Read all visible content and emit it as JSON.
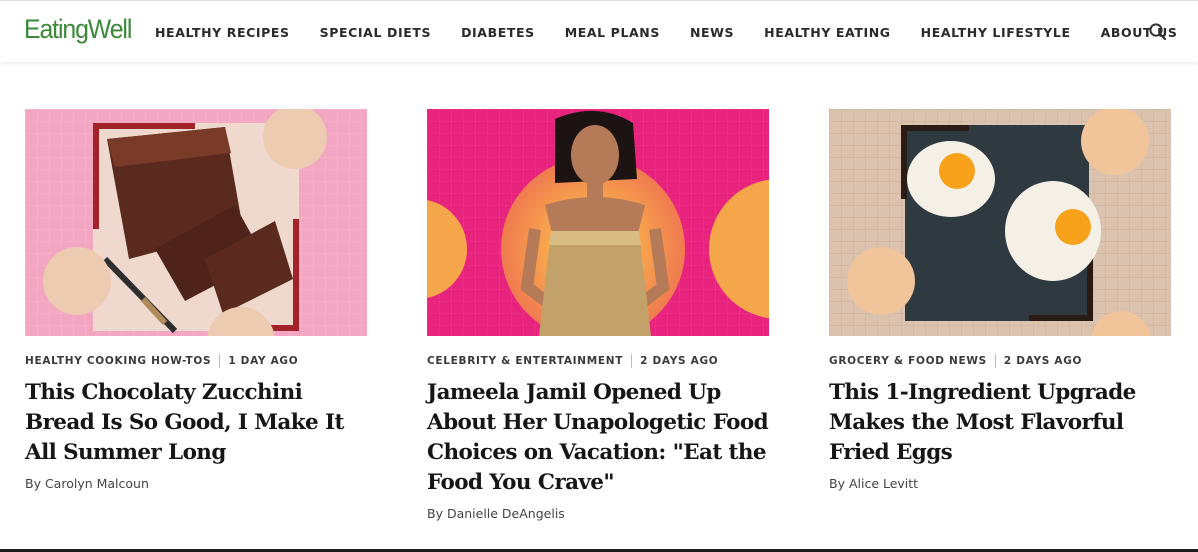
{
  "header": {
    "logo": "EatingWell",
    "nav": [
      "HEALTHY RECIPES",
      "SPECIAL DIETS",
      "DIABETES",
      "MEAL PLANS",
      "NEWS",
      "HEALTHY EATING",
      "HEALTHY LIFESTYLE",
      "ABOUT US"
    ],
    "search_icon": "search-icon"
  },
  "cards": [
    {
      "category": "HEALTHY COOKING HOW-TOS",
      "time": "1 DAY AGO",
      "title": "This Chocolaty Zucchini Bread Is So Good, I Make It All Summer Long",
      "byline": "By Carolyn Malcoun"
    },
    {
      "category": "CELEBRITY & ENTERTAINMENT",
      "time": "2 DAYS AGO",
      "title": "Jameela Jamil Opened Up About Her Unapologetic Food Choices on Vacation: \"Eat the Food You Crave\"",
      "byline": "By Danielle DeAngelis"
    },
    {
      "category": "GROCERY & FOOD NEWS",
      "time": "2 DAYS AGO",
      "title": "This 1-Ingredient Upgrade Makes the Most Flavorful Fried Eggs",
      "byline": "By Alice Levitt"
    }
  ],
  "colors": {
    "brand_green": "#3a8a3a",
    "card1_bg": "#f2a6c2",
    "card2_bg": "#e8237d",
    "card3_bg": "#dcc3b0",
    "peach_circle": "#f1c49a"
  }
}
